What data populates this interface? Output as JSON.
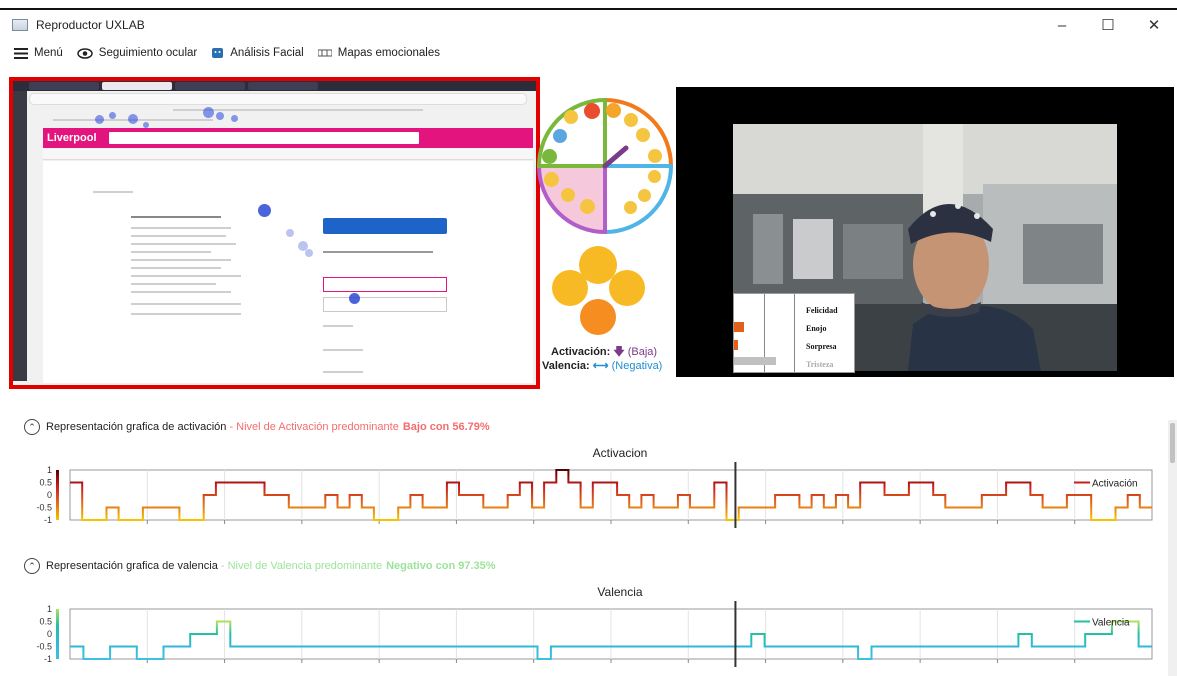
{
  "window": {
    "title": "Reproductor UXLAB",
    "controls": {
      "minimize": "–",
      "maximize": "☐",
      "close": "✕"
    }
  },
  "menubar": {
    "items": [
      {
        "label": "Menú",
        "icon": "hamburger-icon"
      },
      {
        "label": "Seguimiento ocular",
        "icon": "eye-icon"
      },
      {
        "label": "Análisis Facial",
        "icon": "face-icon"
      },
      {
        "label": "Mapas emocionales",
        "icon": "map-icon"
      }
    ]
  },
  "browser_capture": {
    "site_logo": "Liverpool",
    "accent": "#e4147e"
  },
  "emotion_wheel": {
    "activation_label": "Activación:",
    "activation_value": "(Baja)",
    "valence_label": "Valencia:",
    "valence_value": "(Negativa)"
  },
  "camera": {
    "emotions": [
      "Felicidad",
      "Enojo",
      "Sorpresa",
      "Tristeza"
    ]
  },
  "activation_section": {
    "heading": "Representación grafica de activación",
    "sep": " - ",
    "summary_prefix": "Nivel de Activación predominante",
    "summary_value": "Bajo con 56.79%"
  },
  "valence_section": {
    "heading": "Representación grafica de valencia",
    "sep": " - ",
    "summary_prefix": "Nivel de Valencia predominante",
    "summary_value": "Negativo con 97.35%"
  },
  "chart_data": [
    {
      "type": "line",
      "title": "Activacion",
      "series": [
        {
          "name": "Activación",
          "values": [
            0.5,
            -1,
            -1,
            -0.5,
            -1,
            -1,
            -0.5,
            -0.5,
            -0.5,
            -1,
            -1,
            0,
            0.5,
            0.5,
            0.5,
            0.5,
            0,
            0,
            -0.5,
            -0.5,
            -0.5,
            0,
            -0.5,
            0,
            -0.5,
            -1,
            -1,
            -0.5,
            0,
            -0.5,
            -0.5,
            0.5,
            0,
            0,
            -0.5,
            -0.5,
            0,
            0.5,
            -0.5,
            0.5,
            1,
            0.5,
            -0.5,
            0.5,
            0.5,
            0,
            -0.5,
            0,
            -0.5,
            -0.5,
            0,
            -0.5,
            -0.5,
            0.5,
            -1,
            -0.5,
            -0.5,
            -0.5,
            0,
            0,
            -0.5,
            0,
            -0.5,
            0,
            -0.5,
            0.5,
            0.5,
            0,
            0,
            0.5,
            0.5,
            0,
            -0.5,
            -0.5,
            -0.5,
            0,
            0,
            0.5,
            0.5,
            0,
            -0.5,
            -0.5,
            0,
            0,
            -1,
            -1,
            -0.5,
            0,
            -0.5
          ]
        }
      ],
      "ylim": [
        -1,
        1
      ],
      "yticks": [
        "1",
        "0.5",
        "0",
        "-0.5",
        "-1"
      ],
      "colorscale": [
        "#f5c400",
        "#e36b1a",
        "#c81e1e",
        "#5a0000"
      ]
    },
    {
      "type": "line",
      "title": "Valencia",
      "series": [
        {
          "name": "Valencia",
          "values": [
            -0.5,
            -1,
            -1,
            -0.5,
            -0.5,
            -1,
            -1,
            -0.5,
            -0.5,
            0,
            0,
            0.5,
            -0.5,
            -0.5,
            -0.5,
            -0.5,
            -0.5,
            -0.5,
            -0.5,
            -0.5,
            -0.5,
            -0.5,
            -0.5,
            -0.5,
            -0.5,
            -0.5,
            -0.5,
            -0.5,
            -0.5,
            -0.5,
            -0.5,
            -0.5,
            -0.5,
            -0.5,
            -0.5,
            -1,
            -0.5,
            -0.5,
            -0.5,
            -0.5,
            -0.5,
            -0.5,
            -0.5,
            -0.5,
            -0.5,
            -0.5,
            -0.5,
            -0.5,
            -0.5,
            -0.5,
            -0.5,
            0,
            -0.5,
            -0.5,
            -0.5,
            -0.5,
            -0.5,
            -0.5,
            -0.5,
            -1,
            -0.5,
            -0.5,
            -0.5,
            -0.5,
            -0.5,
            -0.5,
            -0.5,
            -0.5,
            -0.5,
            -0.5,
            -0.5,
            0,
            -0.5,
            -0.5,
            -0.5,
            -0.5,
            0,
            0,
            0.5,
            0.5,
            -0.5
          ]
        }
      ],
      "ylim": [
        -1,
        1
      ],
      "yticks": [
        "1",
        "0.5",
        "0",
        "-0.5",
        "-1"
      ],
      "colorscale": [
        "#40c0e0",
        "#30b8d8",
        "#20c0a0",
        "#b0e060"
      ]
    }
  ]
}
